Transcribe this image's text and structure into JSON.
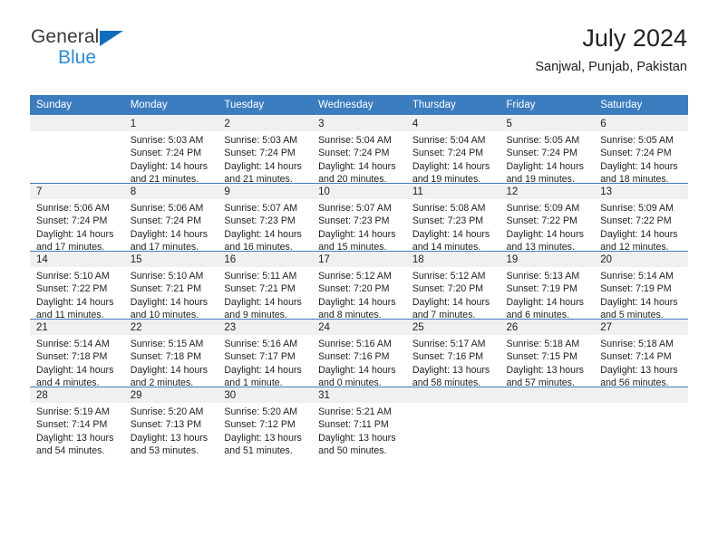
{
  "brand": {
    "name_part1": "General",
    "name_part2": "Blue",
    "triangle_color": "#0f6dbe",
    "blue_color": "#2e8bd4"
  },
  "header": {
    "title": "July 2024",
    "subtitle": "Sanjwal, Punjab, Pakistan"
  },
  "theme": {
    "header_bg": "#3c7dc0",
    "daynum_bg": "#f0f0f0",
    "text": "#222222"
  },
  "calendar": {
    "weekday_headers": [
      "Sunday",
      "Monday",
      "Tuesday",
      "Wednesday",
      "Thursday",
      "Friday",
      "Saturday"
    ],
    "weeks": [
      [
        {
          "day": "",
          "sunrise": "",
          "sunset": "",
          "daylight_line1": "",
          "daylight_line2": "",
          "empty": true
        },
        {
          "day": "1",
          "sunrise": "Sunrise: 5:03 AM",
          "sunset": "Sunset: 7:24 PM",
          "daylight_line1": "Daylight: 14 hours",
          "daylight_line2": "and 21 minutes."
        },
        {
          "day": "2",
          "sunrise": "Sunrise: 5:03 AM",
          "sunset": "Sunset: 7:24 PM",
          "daylight_line1": "Daylight: 14 hours",
          "daylight_line2": "and 21 minutes."
        },
        {
          "day": "3",
          "sunrise": "Sunrise: 5:04 AM",
          "sunset": "Sunset: 7:24 PM",
          "daylight_line1": "Daylight: 14 hours",
          "daylight_line2": "and 20 minutes."
        },
        {
          "day": "4",
          "sunrise": "Sunrise: 5:04 AM",
          "sunset": "Sunset: 7:24 PM",
          "daylight_line1": "Daylight: 14 hours",
          "daylight_line2": "and 19 minutes."
        },
        {
          "day": "5",
          "sunrise": "Sunrise: 5:05 AM",
          "sunset": "Sunset: 7:24 PM",
          "daylight_line1": "Daylight: 14 hours",
          "daylight_line2": "and 19 minutes."
        },
        {
          "day": "6",
          "sunrise": "Sunrise: 5:05 AM",
          "sunset": "Sunset: 7:24 PM",
          "daylight_line1": "Daylight: 14 hours",
          "daylight_line2": "and 18 minutes."
        }
      ],
      [
        {
          "day": "7",
          "sunrise": "Sunrise: 5:06 AM",
          "sunset": "Sunset: 7:24 PM",
          "daylight_line1": "Daylight: 14 hours",
          "daylight_line2": "and 17 minutes."
        },
        {
          "day": "8",
          "sunrise": "Sunrise: 5:06 AM",
          "sunset": "Sunset: 7:24 PM",
          "daylight_line1": "Daylight: 14 hours",
          "daylight_line2": "and 17 minutes."
        },
        {
          "day": "9",
          "sunrise": "Sunrise: 5:07 AM",
          "sunset": "Sunset: 7:23 PM",
          "daylight_line1": "Daylight: 14 hours",
          "daylight_line2": "and 16 minutes."
        },
        {
          "day": "10",
          "sunrise": "Sunrise: 5:07 AM",
          "sunset": "Sunset: 7:23 PM",
          "daylight_line1": "Daylight: 14 hours",
          "daylight_line2": "and 15 minutes."
        },
        {
          "day": "11",
          "sunrise": "Sunrise: 5:08 AM",
          "sunset": "Sunset: 7:23 PM",
          "daylight_line1": "Daylight: 14 hours",
          "daylight_line2": "and 14 minutes."
        },
        {
          "day": "12",
          "sunrise": "Sunrise: 5:09 AM",
          "sunset": "Sunset: 7:22 PM",
          "daylight_line1": "Daylight: 14 hours",
          "daylight_line2": "and 13 minutes."
        },
        {
          "day": "13",
          "sunrise": "Sunrise: 5:09 AM",
          "sunset": "Sunset: 7:22 PM",
          "daylight_line1": "Daylight: 14 hours",
          "daylight_line2": "and 12 minutes."
        }
      ],
      [
        {
          "day": "14",
          "sunrise": "Sunrise: 5:10 AM",
          "sunset": "Sunset: 7:22 PM",
          "daylight_line1": "Daylight: 14 hours",
          "daylight_line2": "and 11 minutes."
        },
        {
          "day": "15",
          "sunrise": "Sunrise: 5:10 AM",
          "sunset": "Sunset: 7:21 PM",
          "daylight_line1": "Daylight: 14 hours",
          "daylight_line2": "and 10 minutes."
        },
        {
          "day": "16",
          "sunrise": "Sunrise: 5:11 AM",
          "sunset": "Sunset: 7:21 PM",
          "daylight_line1": "Daylight: 14 hours",
          "daylight_line2": "and 9 minutes."
        },
        {
          "day": "17",
          "sunrise": "Sunrise: 5:12 AM",
          "sunset": "Sunset: 7:20 PM",
          "daylight_line1": "Daylight: 14 hours",
          "daylight_line2": "and 8 minutes."
        },
        {
          "day": "18",
          "sunrise": "Sunrise: 5:12 AM",
          "sunset": "Sunset: 7:20 PM",
          "daylight_line1": "Daylight: 14 hours",
          "daylight_line2": "and 7 minutes."
        },
        {
          "day": "19",
          "sunrise": "Sunrise: 5:13 AM",
          "sunset": "Sunset: 7:19 PM",
          "daylight_line1": "Daylight: 14 hours",
          "daylight_line2": "and 6 minutes."
        },
        {
          "day": "20",
          "sunrise": "Sunrise: 5:14 AM",
          "sunset": "Sunset: 7:19 PM",
          "daylight_line1": "Daylight: 14 hours",
          "daylight_line2": "and 5 minutes."
        }
      ],
      [
        {
          "day": "21",
          "sunrise": "Sunrise: 5:14 AM",
          "sunset": "Sunset: 7:18 PM",
          "daylight_line1": "Daylight: 14 hours",
          "daylight_line2": "and 4 minutes."
        },
        {
          "day": "22",
          "sunrise": "Sunrise: 5:15 AM",
          "sunset": "Sunset: 7:18 PM",
          "daylight_line1": "Daylight: 14 hours",
          "daylight_line2": "and 2 minutes."
        },
        {
          "day": "23",
          "sunrise": "Sunrise: 5:16 AM",
          "sunset": "Sunset: 7:17 PM",
          "daylight_line1": "Daylight: 14 hours",
          "daylight_line2": "and 1 minute."
        },
        {
          "day": "24",
          "sunrise": "Sunrise: 5:16 AM",
          "sunset": "Sunset: 7:16 PM",
          "daylight_line1": "Daylight: 14 hours",
          "daylight_line2": "and 0 minutes."
        },
        {
          "day": "25",
          "sunrise": "Sunrise: 5:17 AM",
          "sunset": "Sunset: 7:16 PM",
          "daylight_line1": "Daylight: 13 hours",
          "daylight_line2": "and 58 minutes."
        },
        {
          "day": "26",
          "sunrise": "Sunrise: 5:18 AM",
          "sunset": "Sunset: 7:15 PM",
          "daylight_line1": "Daylight: 13 hours",
          "daylight_line2": "and 57 minutes."
        },
        {
          "day": "27",
          "sunrise": "Sunrise: 5:18 AM",
          "sunset": "Sunset: 7:14 PM",
          "daylight_line1": "Daylight: 13 hours",
          "daylight_line2": "and 56 minutes."
        }
      ],
      [
        {
          "day": "28",
          "sunrise": "Sunrise: 5:19 AM",
          "sunset": "Sunset: 7:14 PM",
          "daylight_line1": "Daylight: 13 hours",
          "daylight_line2": "and 54 minutes."
        },
        {
          "day": "29",
          "sunrise": "Sunrise: 5:20 AM",
          "sunset": "Sunset: 7:13 PM",
          "daylight_line1": "Daylight: 13 hours",
          "daylight_line2": "and 53 minutes."
        },
        {
          "day": "30",
          "sunrise": "Sunrise: 5:20 AM",
          "sunset": "Sunset: 7:12 PM",
          "daylight_line1": "Daylight: 13 hours",
          "daylight_line2": "and 51 minutes."
        },
        {
          "day": "31",
          "sunrise": "Sunrise: 5:21 AM",
          "sunset": "Sunset: 7:11 PM",
          "daylight_line1": "Daylight: 13 hours",
          "daylight_line2": "and 50 minutes."
        },
        {
          "day": "",
          "sunrise": "",
          "sunset": "",
          "daylight_line1": "",
          "daylight_line2": "",
          "empty": true
        },
        {
          "day": "",
          "sunrise": "",
          "sunset": "",
          "daylight_line1": "",
          "daylight_line2": "",
          "empty": true
        },
        {
          "day": "",
          "sunrise": "",
          "sunset": "",
          "daylight_line1": "",
          "daylight_line2": "",
          "empty": true
        }
      ]
    ]
  }
}
